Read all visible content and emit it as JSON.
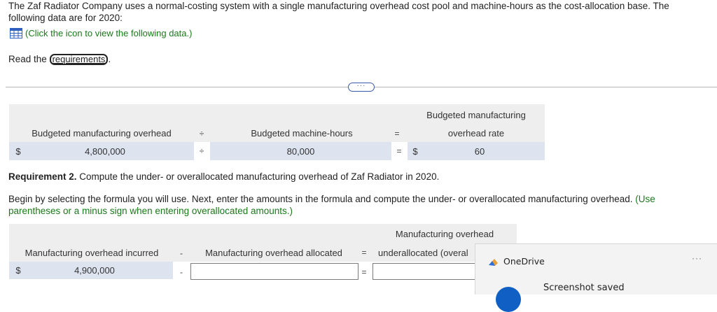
{
  "intro": {
    "text": "The Zaf Radiator Company uses a normal-costing system with a single manufacturing overhead cost pool and machine-hours as the cost-allocation base. The following data are for 2020:",
    "click_label": "(Click the icon to view the following data.)",
    "read_prefix": "Read the",
    "requirements_link": "requirements",
    "read_suffix": "."
  },
  "more_button": "···",
  "rate_table": {
    "col1_header": "Budgeted manufacturing overhead",
    "op1": "÷",
    "col2_header": "Budgeted machine-hours",
    "op2": "=",
    "col3_header_line1": "Budgeted manufacturing",
    "col3_header_line2": "overhead rate",
    "row_currency1": "$",
    "row_value1": "4,800,000",
    "row_op1": "÷",
    "row_value2": "80,000",
    "row_op2": "=",
    "row_currency3": "$",
    "row_value3": "60"
  },
  "requirement": {
    "title": "Requirement 2.",
    "text": " Compute the under- or overallocated manufacturing overhead of Zaf Radiator in 2020.",
    "instructions": "Begin by selecting the formula you will use. Next, enter the amounts in the formula and compute the under- or overallocated manufacturing overhead.",
    "instructions_green": " (Use parentheses or a minus sign when entering overallocated amounts.)"
  },
  "alloc_table": {
    "col3_header_line1": "Manufacturing overhead",
    "col1_header": "Manufacturing overhead incurred",
    "op1": "-",
    "col2_header": "Manufacturing overhead allocated",
    "op2": "=",
    "col3_header_line2": "underallocated (overal",
    "row_currency1": "$",
    "row_value1": "4,900,000",
    "row_op1": "-",
    "row_op2": "=",
    "allocated_value": "",
    "result_value": ""
  },
  "toast": {
    "app": "OneDrive",
    "dots": "···",
    "message": "Screenshot saved"
  },
  "colors": {
    "green_text": "#1a7a1a",
    "header_gray": "#eeeeee",
    "value_blue": "#dde4f0",
    "grid_icon": "#2f5fbf"
  }
}
